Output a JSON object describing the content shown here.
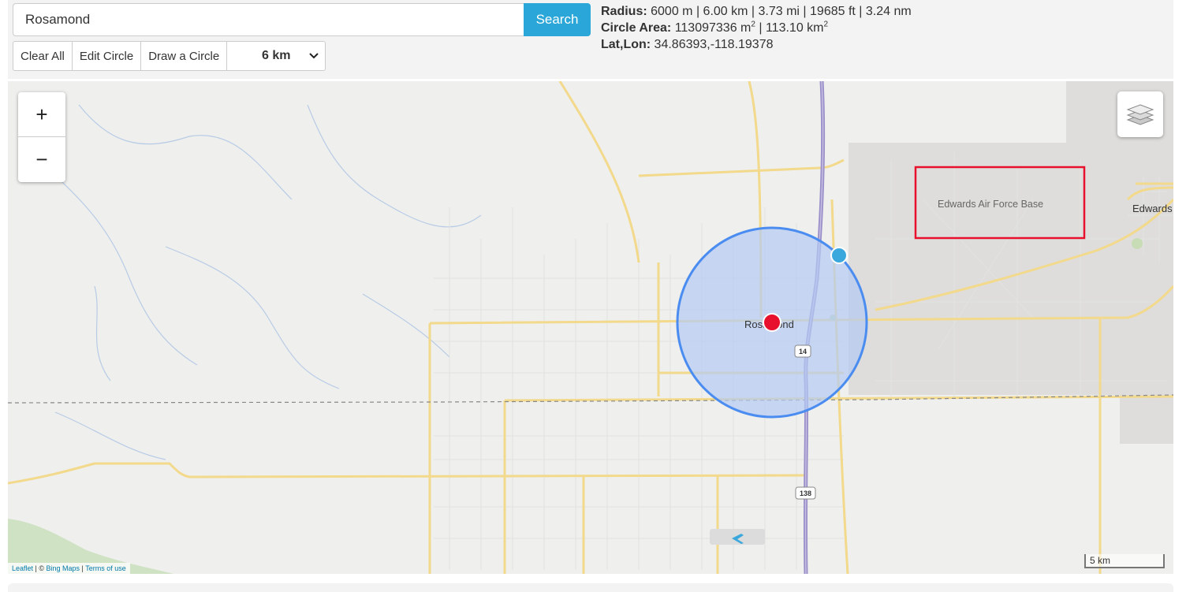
{
  "search": {
    "value": "Rosamond",
    "button_label": "Search"
  },
  "toolbar": {
    "clear_label": "Clear All",
    "edit_label": "Edit Circle",
    "draw_label": "Draw a Circle",
    "radius_selected": "6 km"
  },
  "info": {
    "radius_label": "Radius:",
    "radius_value": "6000 m | 6.00 km | 3.73 mi | 19685 ft | 3.24 nm",
    "area_label": "Circle Area:",
    "area_m2": "113097336 m",
    "area_sep": " | ",
    "area_km2": "113.10 km",
    "area_exp": "2",
    "latlon_label": "Lat,Lon:",
    "latlon_value": "34.86393,-118.19378"
  },
  "map": {
    "zoom_in": "+",
    "zoom_out": "−",
    "labels": {
      "town": "Rosamond",
      "base": "Edwards Air Force Base",
      "edwards": "Edwards",
      "hwy14": "14",
      "hwy138": "138"
    },
    "attribution": {
      "leaflet": "Leaflet",
      "sep1": " | © ",
      "bing": "Bing Maps",
      "sep2": " | ",
      "terms": "Terms of use"
    },
    "scale": "5 km",
    "icons": [
      "plus-icon",
      "minus-icon",
      "layers-icon",
      "airport-icon",
      "chevron-down-icon"
    ],
    "colors": {
      "circle_fill": "#b4cbf3",
      "circle_stroke": "#4a8cf0",
      "center_marker": "#e8112d",
      "edge_marker": "#3aa8dc",
      "highlight_box": "#e8112d",
      "interstate": "#9b8fc9",
      "roads": "#f2d98b"
    }
  }
}
